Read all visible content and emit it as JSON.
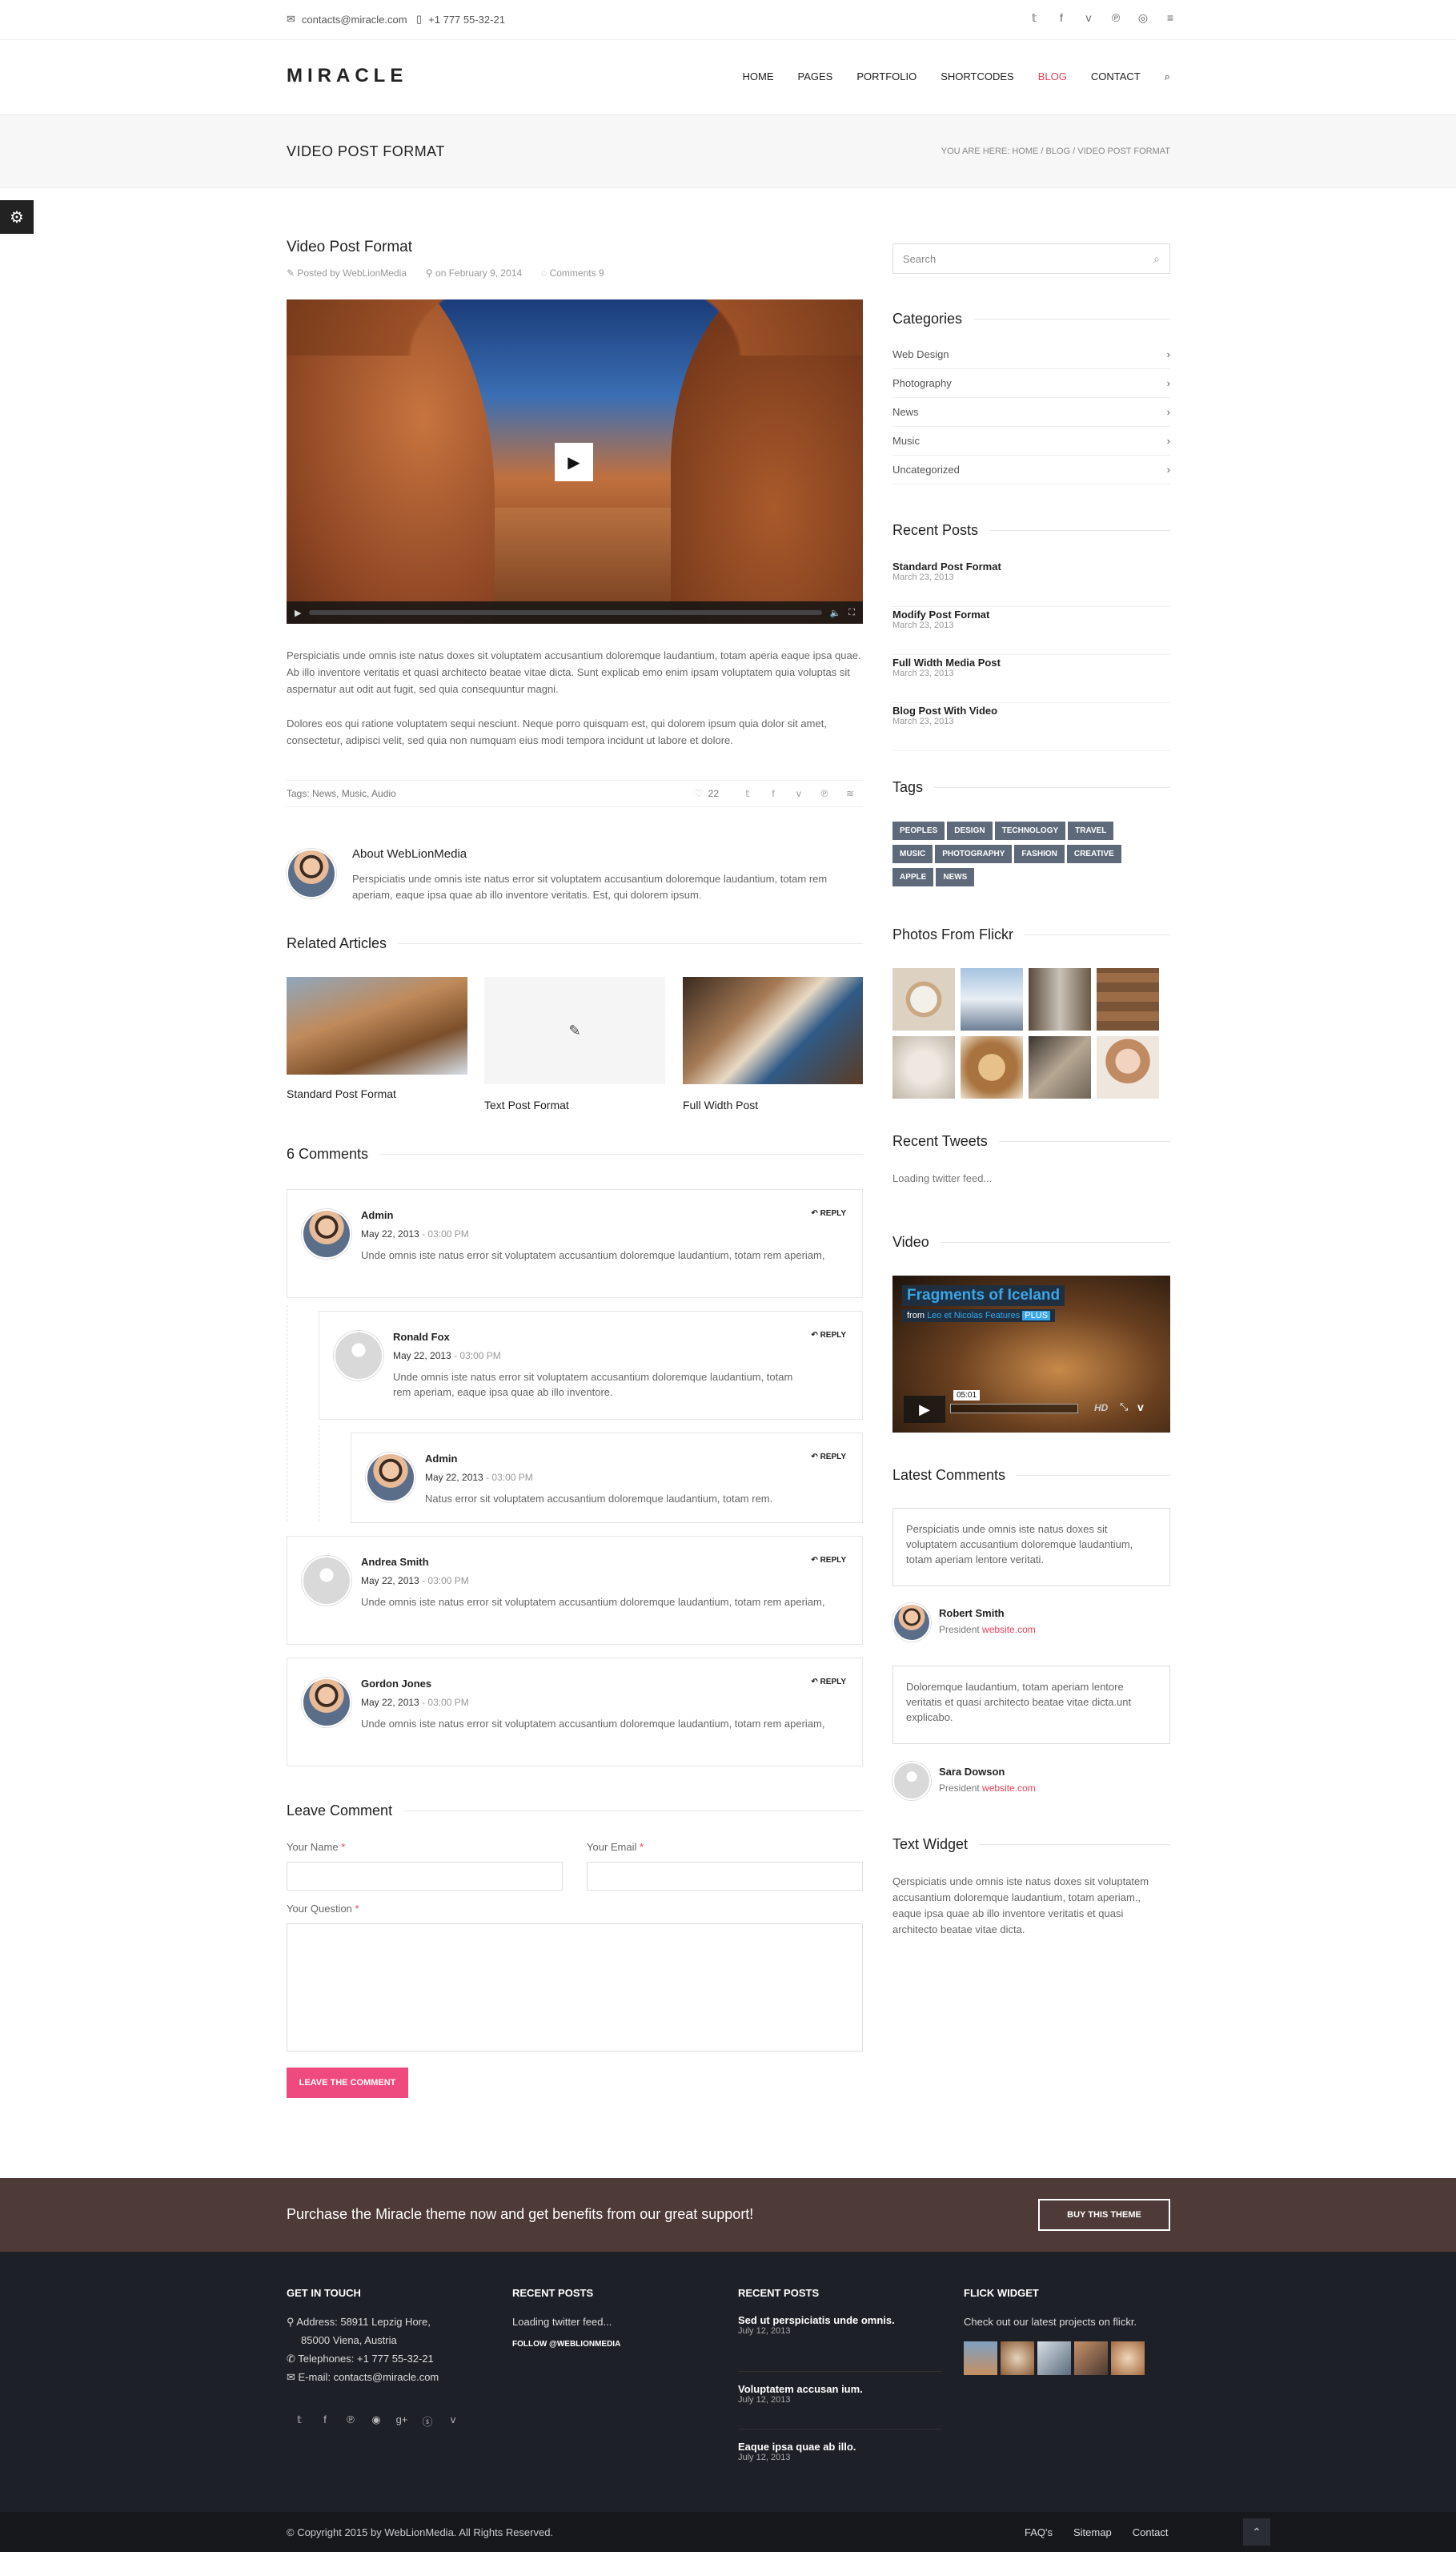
{
  "topbar": {
    "email": "contacts@miracle.com",
    "phone": "+1 777 55-32-21",
    "social_icons": [
      "twitter-icon",
      "facebook-icon",
      "vimeo-icon",
      "pinterest-icon",
      "instagram-icon",
      "menu-icon"
    ],
    "social_glyphs": [
      "𝕥",
      "f",
      "v",
      "℗",
      "◎",
      "≡"
    ]
  },
  "header": {
    "logo": "MIRACLE",
    "nav": [
      "HOME",
      "PAGES",
      "PORTFOLIO",
      "SHORTCODES",
      "BLOG",
      "CONTACT"
    ],
    "active": "BLOG"
  },
  "titlebar": {
    "title": "VIDEO POST FORMAT",
    "breadcrumb": "YOU ARE HERE: HOME / BLOG / VIDEO POST FORMAT"
  },
  "post": {
    "title": "Video Post Format",
    "author": "Posted by WebLionMedia",
    "date": "on February 9, 2014",
    "comments": "Comments 9",
    "video_progress": 0,
    "para1": "Perspiciatis unde omnis iste natus doxes sit voluptatem accusantium doloremque laudantium, totam aperia eaque ipsa quae. Ab illo inventore veritatis et quasi architecto beatae vitae dicta. Sunt explicab emo enim ipsam voluptatem quia voluptas sit aspernatur aut odit aut fugit, sed quia consequuntur magni.",
    "para2": "Dolores eos qui ratione voluptatem sequi nesciunt. Neque porro quisquam est, qui dolorem ipsum quia dolor sit amet, consectetur, adipisci velit, sed quia non numquam eius modi tempora incidunt ut labore et dolore.",
    "tags": "Tags: News, Music, Audio",
    "likes": "22",
    "author_box": {
      "name": "About WebLionMedia",
      "text": "Perspiciatis unde omnis iste natus error sit voluptatem accusantium doloremque laudantium, totam rem aperiam, eaque ipsa quae ab illo inventore veritatis. Est, qui dolorem ipsum."
    }
  },
  "related": {
    "heading": "Related Articles",
    "items": [
      "Standard Post Format",
      "Text Post Format",
      "Full Width Post"
    ]
  },
  "comments": {
    "heading": "6 Comments",
    "reply": "REPLY",
    "list": [
      {
        "name": "Admin",
        "date": "May 22, 2013",
        "time": "- 03:00 PM",
        "text": "Unde omnis iste natus error sit voluptatem accusantium doloremque laudantium, totam rem aperiam,"
      },
      {
        "name": "Ronald Fox",
        "date": "May 22, 2013",
        "time": "- 03:00 PM",
        "text": "Unde omnis iste natus error sit voluptatem accusantium doloremque laudantium, totam rem aperiam, eaque ipsa quae ab illo inventore."
      },
      {
        "name": "Admin",
        "date": "May 22, 2013",
        "time": "- 03:00 PM",
        "text": "Natus error sit voluptatem accusantium doloremque laudantium, totam rem."
      },
      {
        "name": "Andrea Smith",
        "date": "May 22, 2013",
        "time": "- 03:00 PM",
        "text": "Unde omnis iste natus error sit voluptatem accusantium doloremque laudantium, totam rem aperiam,"
      },
      {
        "name": "Gordon Jones",
        "date": "May 22, 2013",
        "time": "- 03:00 PM",
        "text": "Unde omnis iste natus error sit voluptatem accusantium doloremque laudantium, totam rem aperiam,"
      }
    ]
  },
  "form": {
    "heading": "Leave Comment",
    "name_label": "Your Name",
    "email_label": "Your Email",
    "question_label": "Your Question",
    "required": "*",
    "submit": "LEAVE THE COMMENT"
  },
  "sidebar": {
    "search_placeholder": "Search",
    "categories_heading": "Categories",
    "categories": [
      "Web Design",
      "Photography",
      "News",
      "Music",
      "Uncategorized"
    ],
    "recent_heading": "Recent Posts",
    "recent": [
      {
        "title": "Standard Post Format",
        "date": "March 23, 2013"
      },
      {
        "title": "Modify Post Format",
        "date": "March 23, 2013"
      },
      {
        "title": "Full Width Media Post",
        "date": "March 23, 2013"
      },
      {
        "title": "Blog Post With Video",
        "date": "March 23, 2013"
      }
    ],
    "tags_heading": "Tags",
    "tags": [
      "PEOPLES",
      "DESIGN",
      "TECHNOLOGY",
      "TRAVEL",
      "MUSIC",
      "PHOTOGRAPHY",
      "FASHION",
      "CREATIVE",
      "APPLE",
      "NEWS"
    ],
    "flickr_heading": "Photos From Flickr",
    "tweets_heading": "Recent Tweets",
    "tweets_text": "Loading twitter feed...",
    "video_heading": "Video",
    "video_title": "Fragments of Iceland",
    "video_from": "from",
    "video_author": "Leo et Nicolas Features",
    "video_badge": "PLUS",
    "video_time": "05:01",
    "video_hd": "HD",
    "latest_heading": "Latest Comments",
    "latest": [
      {
        "text": "Perspiciatis unde omnis iste natus doxes sit voluptatem accusantium doloremque laudantium, totam aperiam lentore veritati.",
        "name": "Robert Smith",
        "role": "President",
        "site": "website.com"
      },
      {
        "text": "Doloremque laudantium, totam aperiam lentore veritatis et quasi architecto beatae vitae dicta.unt explicabo.",
        "name": "Sara Dowson",
        "role": "President",
        "site": "website.com"
      }
    ],
    "text_heading": "Text Widget",
    "text_body": "Qerspiciatis unde omnis iste natus doxes sit voluptatem accusantium doloremque laudantium, totam aperiam., eaque ipsa quae ab illo inventore veritatis et quasi architecto beatae vitae dicta."
  },
  "cta": {
    "text": "Purchase the Miracle theme now and get benefits from our great support!",
    "button": "BUY THIS THEME"
  },
  "footer": {
    "col1_heading": "GET IN TOUCH",
    "address": "Address: 58911 Lepzig Hore,",
    "address2": "85000 Viena, Austria",
    "telephones": "Telephones: +1 777 55-32-21",
    "email": "E-mail: contacts@miracle.com",
    "col2_heading": "RECENT POSTS",
    "col2_text": "Loading twitter feed...",
    "col2_follow": "FOLLOW @WEBLIONMEDIA",
    "col3_heading": "RECENT POSTS",
    "col3_posts": [
      {
        "title": "Sed ut perspiciatis unde omnis.",
        "date": "July 12, 2013"
      },
      {
        "title": "Voluptatem accusan ium.",
        "date": "July 12, 2013"
      },
      {
        "title": "Eaque ipsa quae ab illo.",
        "date": "July 12, 2013"
      }
    ],
    "col4_heading": "FLICK WIDGET",
    "col4_text": "Check out our latest projects on flickr.",
    "social_glyphs": [
      "𝕥",
      "f",
      "℗",
      "◉",
      "g+",
      "ⓢ",
      "v"
    ]
  },
  "bottom": {
    "copyright": "© Copyright 2015 by WebLionMedia. All Rights Reserved.",
    "links": [
      "FAQ's",
      "Sitemap",
      "Contact"
    ],
    "top_glyph": "⌃"
  },
  "colors": {
    "accent": "#e8425a",
    "button": "#ee4a7f",
    "cta_bg": "#4e3a36",
    "footer_bg": "#1d2026"
  }
}
